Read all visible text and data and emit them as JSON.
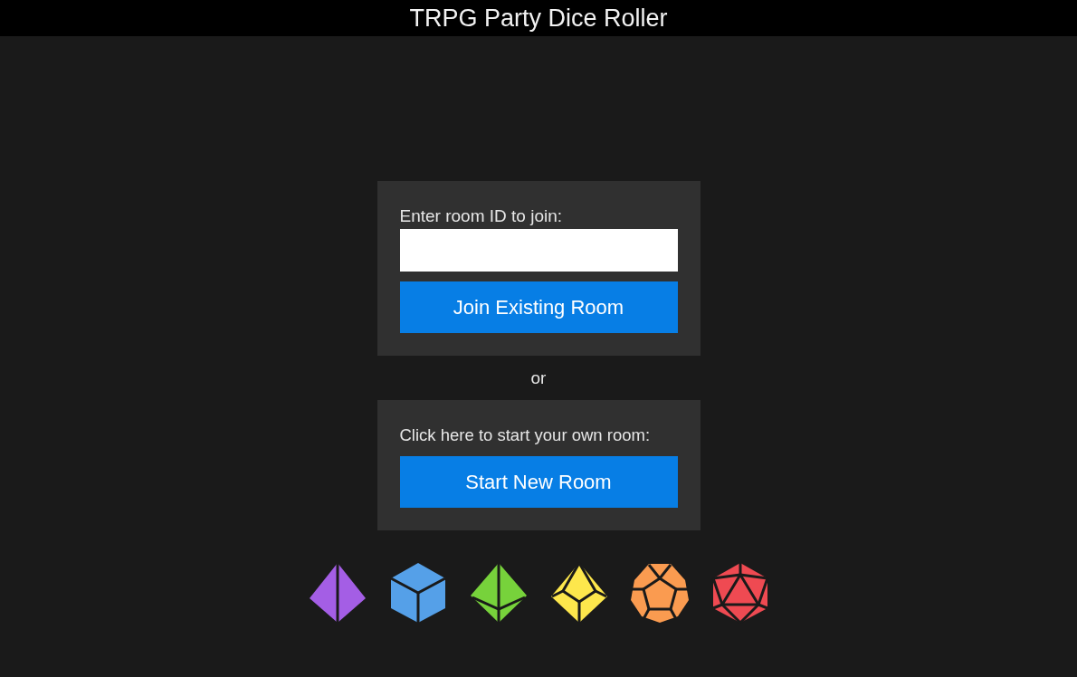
{
  "header": {
    "title": "TRPG Party Dice Roller"
  },
  "join_panel": {
    "label": "Enter room ID to join:",
    "button": "Join Existing Room"
  },
  "separator": "or",
  "start_panel": {
    "label": "Click here to start your own room:",
    "button": "Start New Room"
  }
}
